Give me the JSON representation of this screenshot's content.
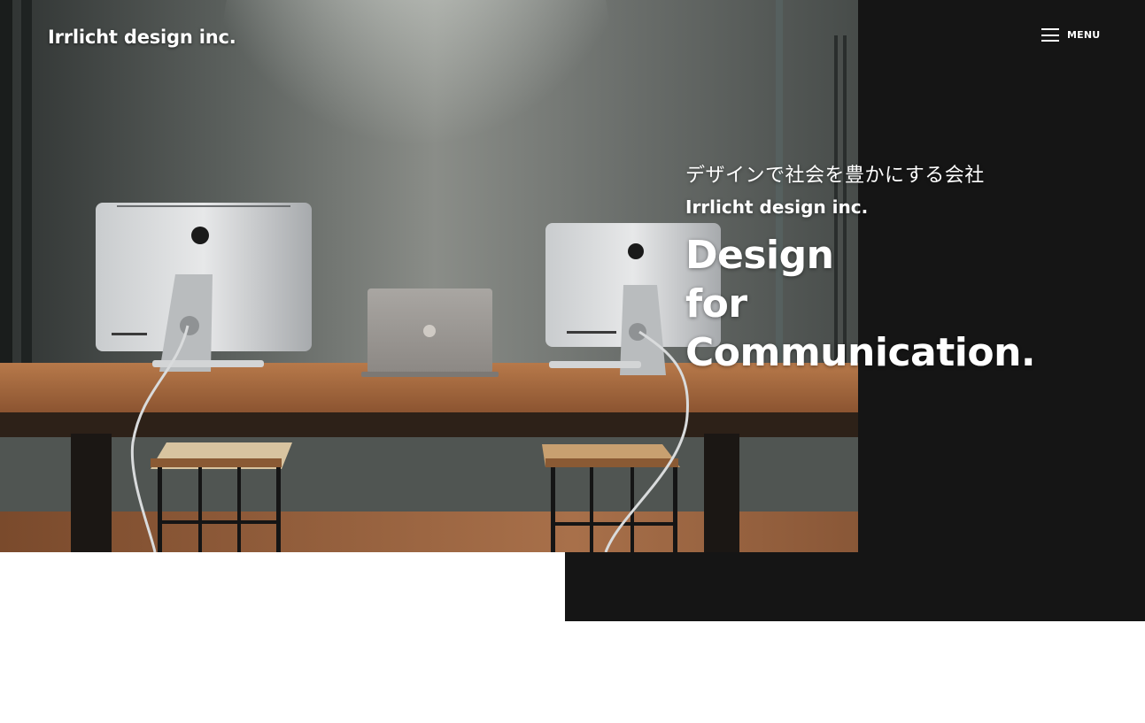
{
  "header": {
    "logo": "Irrlicht design inc.",
    "menu_label": "MENU"
  },
  "hero": {
    "tagline_jp": "デザインで社会を豊かにする会社",
    "company_name": "Irrlicht design inc.",
    "headline_lines": [
      "Design",
      "for",
      "Communication."
    ]
  },
  "colors": {
    "panel": "#151515",
    "text": "#ffffff",
    "background": "#ffffff"
  },
  "icons": {
    "menu": "hamburger-icon"
  }
}
